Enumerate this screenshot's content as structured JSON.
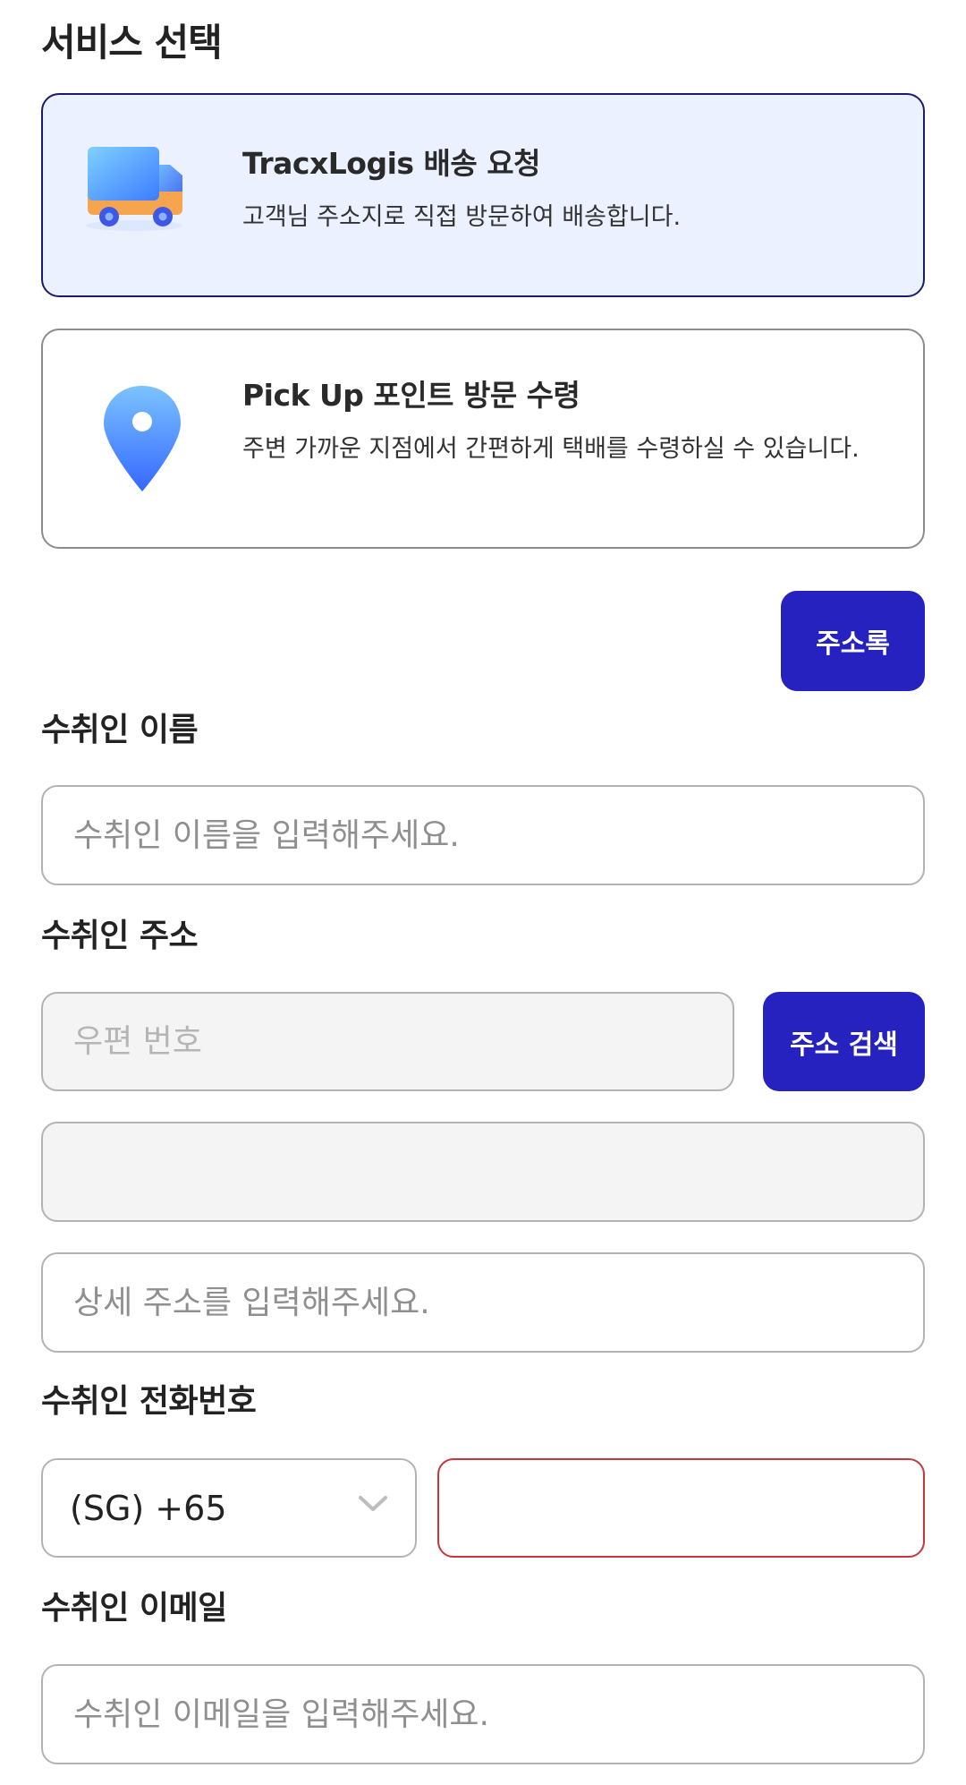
{
  "service": {
    "title": "서비스 선택",
    "options": [
      {
        "title": "TracxLogis 배송 요청",
        "description": "고객님 주소지로 직접 방문하여 배송합니다.",
        "icon": "delivery-truck-icon",
        "selected": true
      },
      {
        "title": "Pick Up 포인트 방문 수령",
        "description": "주변 가까운 지점에서 간편하게 택배를 수령하실 수 있습니다.",
        "icon": "map-pin-icon",
        "selected": false
      }
    ]
  },
  "address_book_label": "주소록",
  "recipient": {
    "name_label": "수취인 이름",
    "name_placeholder": "수취인 이름을 입력해주세요.",
    "address_label": "수취인 주소",
    "zip_placeholder": "우편 번호",
    "search_label": "주소 검색",
    "detail_placeholder": "상세 주소를 입력해주세요.",
    "phone_label": "수취인 전화번호",
    "country_code": "(SG) +65",
    "email_label": "수취인 이메일",
    "email_placeholder": "수취인 이메일을 입력해주세요."
  },
  "colors": {
    "primary": "#2522c0",
    "selected_card_bg": "#ebf1ff",
    "selected_card_border": "#1b1b6b",
    "error_border": "#c9353f"
  }
}
